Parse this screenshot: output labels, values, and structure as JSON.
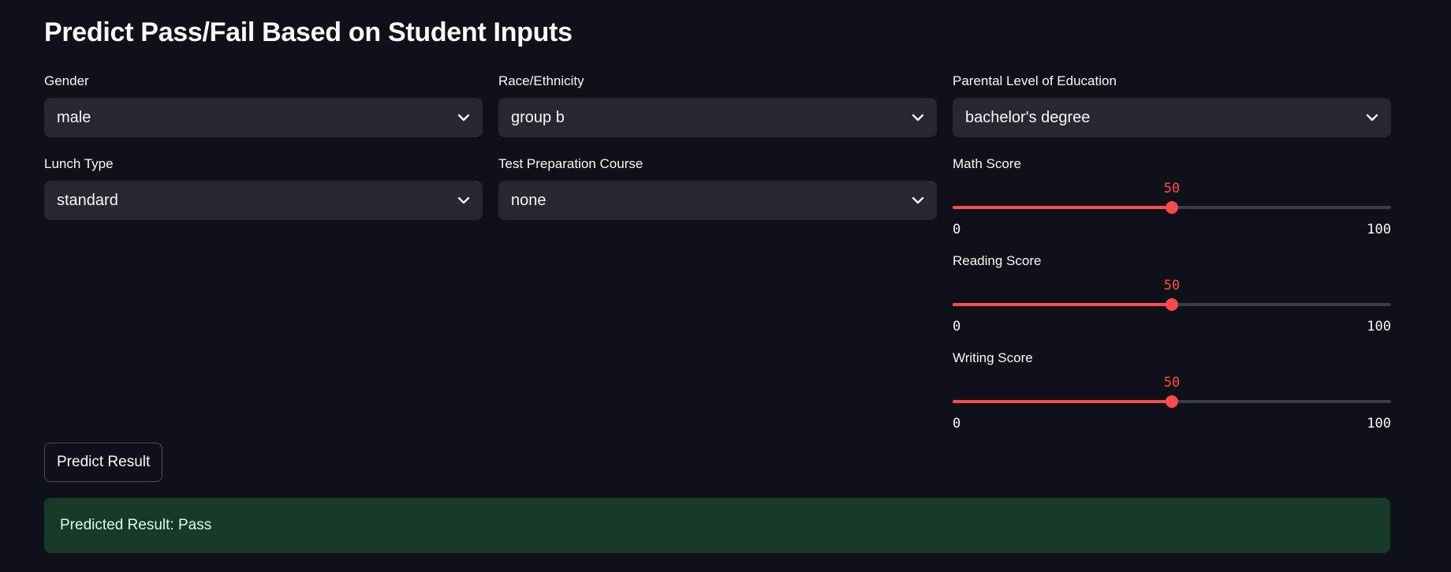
{
  "title": "Predict Pass/Fail Based on Student Inputs",
  "fields": {
    "gender": {
      "label": "Gender",
      "value": "male",
      "icon": "chevron-down-icon"
    },
    "race": {
      "label": "Race/Ethnicity",
      "value": "group b",
      "icon": "chevron-down-icon"
    },
    "parental_education": {
      "label": "Parental Level of Education",
      "value": "bachelor's degree",
      "icon": "chevron-down-icon"
    },
    "lunch": {
      "label": "Lunch Type",
      "value": "standard",
      "icon": "chevron-down-icon"
    },
    "test_prep": {
      "label": "Test Preparation Course",
      "value": "none",
      "icon": "chevron-down-icon"
    }
  },
  "sliders": {
    "math": {
      "label": "Math Score",
      "value": 50,
      "min": 0,
      "max": 100
    },
    "reading": {
      "label": "Reading Score",
      "value": 50,
      "min": 0,
      "max": 100
    },
    "writing": {
      "label": "Writing Score",
      "value": 50,
      "min": 0,
      "max": 100
    }
  },
  "predict_button": {
    "label": "Predict Result"
  },
  "result": {
    "text": "Predicted Result: Pass"
  },
  "colors": {
    "background": "#0e1117",
    "input_background": "#262730",
    "accent": "#ff4b4b",
    "track": "#3a3c47",
    "success_background": "#173928",
    "success_text": "#dffde9"
  }
}
